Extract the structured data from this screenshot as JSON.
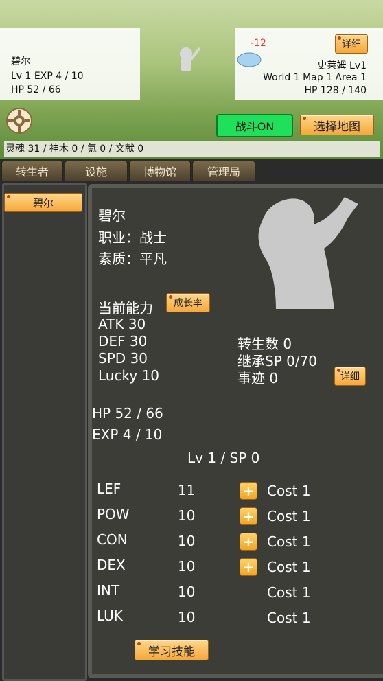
{
  "player": {
    "name": "碧尔",
    "level_exp": "Lv 1 EXP 4 / 10",
    "hp": "HP 52 / 66"
  },
  "enemy": {
    "damage": "-12",
    "name": "史莱姆 Lv1",
    "location": "World 1 Map 1 Area 1",
    "hp": "HP 128 / 140",
    "detail_label": "详细"
  },
  "controls": {
    "battle_label": "战斗ON",
    "map_label": "选择地图"
  },
  "resources": "灵魂 31 / 神木 0 / 氪 0 / 文献 0",
  "tabs": [
    "转生者",
    "设施",
    "博物馆",
    "管理局"
  ],
  "sidebar": {
    "selected_character": "碧尔"
  },
  "character": {
    "name": "碧尔",
    "job": "职业：战士",
    "quality": "素质：平凡",
    "ability_title": "当前能力",
    "growth_label": "成长率",
    "atk": "ATK 30",
    "def": "DEF 30",
    "spd": "SPD 30",
    "lucky": "Lucky 10",
    "rebirth": "转生数 0",
    "inherit_sp": "继承SP 0/70",
    "deeds": "事迹 0",
    "detail_label": "详细",
    "hp": "HP 52 / 66",
    "exp": "EXP 4 / 10",
    "lv_sp": "Lv 1 / SP 0",
    "stats": [
      {
        "name": "LEF",
        "value": "11",
        "cost": "Cost 1",
        "upgradable": true
      },
      {
        "name": "POW",
        "value": "10",
        "cost": "Cost 1",
        "upgradable": true
      },
      {
        "name": "CON",
        "value": "10",
        "cost": "Cost 1",
        "upgradable": true
      },
      {
        "name": "DEX",
        "value": "10",
        "cost": "Cost 1",
        "upgradable": true
      },
      {
        "name": "INT",
        "value": "10",
        "cost": "Cost 1",
        "upgradable": false
      },
      {
        "name": "LUK",
        "value": "10",
        "cost": "Cost 1",
        "upgradable": false
      }
    ],
    "learn_skill_label": "学习技能"
  },
  "colors": {
    "accent_orange": "#f6a83a",
    "battle_green": "#1fe05a",
    "damage_red": "#e53935"
  }
}
